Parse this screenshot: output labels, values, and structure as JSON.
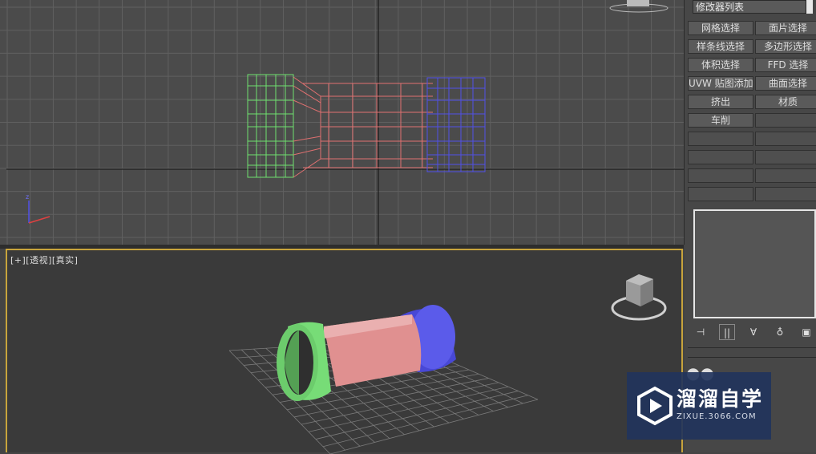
{
  "top_viewport": {
    "name": "top-view"
  },
  "bottom_viewport": {
    "label": "[+][透视][真实]"
  },
  "command_panel": {
    "modifier_list_label": "修改器列表",
    "buttons": [
      [
        "网格选择",
        "面片选择"
      ],
      [
        "样条线选择",
        "多边形选择"
      ],
      [
        "体积选择",
        "FFD 选择"
      ],
      [
        "UVW 贴图添加",
        "曲面选择"
      ],
      [
        "挤出",
        "材质"
      ],
      [
        "车削",
        ""
      ],
      [
        "",
        ""
      ],
      [
        "",
        ""
      ],
      [
        "",
        ""
      ],
      [
        "",
        ""
      ]
    ],
    "toolbar": [
      "⊣",
      "|| ",
      "∀",
      "♁",
      "▣"
    ]
  },
  "watermark": {
    "title": "溜溜自学",
    "subtitle": "ZIXUE.3066.COM"
  },
  "colors": {
    "green": "#6fe06f",
    "red": "#e07070",
    "blue": "#5050e8",
    "accent": "#c8a43c"
  }
}
